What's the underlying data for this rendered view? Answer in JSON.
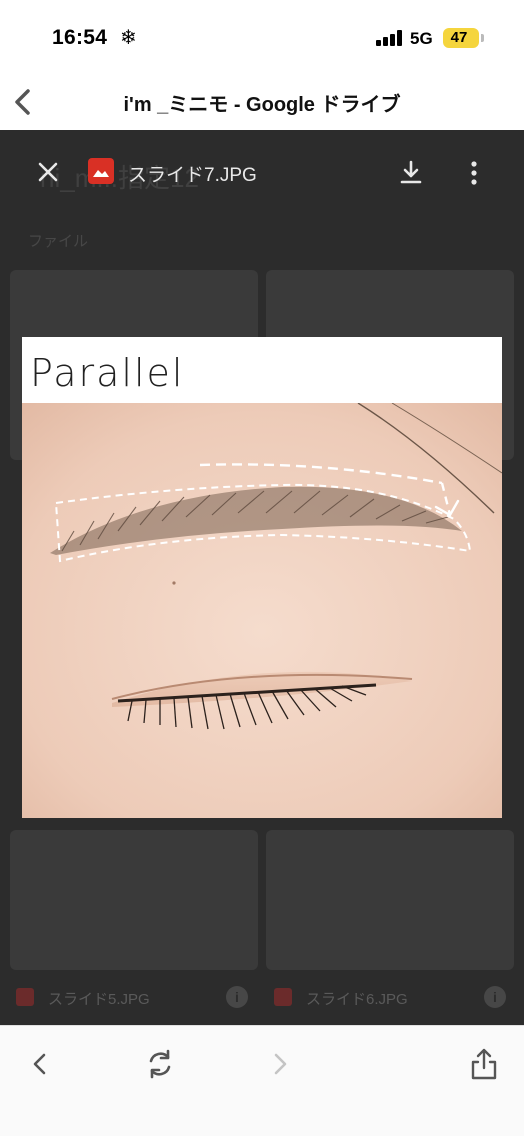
{
  "status": {
    "time": "16:54",
    "weather_glyph": "❄",
    "network": "5G",
    "battery": "47",
    "battery_color": "#f5d53d"
  },
  "browser": {
    "title": "i'm _ミニモ - Google ドライブ",
    "back_icon": "chevron-left-icon"
  },
  "viewer": {
    "file_name": "スライド7.JPG",
    "file_icon": "image-file-icon",
    "file_icon_color": "#d93025",
    "close_icon": "close-icon",
    "download_icon": "download-icon",
    "more_icon": "more-vertical-icon",
    "background": {
      "heading": "ni_m...指定12",
      "files_label": "ファイル",
      "left_file": "スライド5.JPG",
      "right_file": "スライド6.JPG"
    }
  },
  "photo": {
    "label": "Parallel"
  },
  "toolbar": {
    "back_icon": "chevron-left-icon",
    "reload_icon": "reload-icon",
    "forward_icon": "chevron-right-icon",
    "share_icon": "share-icon"
  }
}
